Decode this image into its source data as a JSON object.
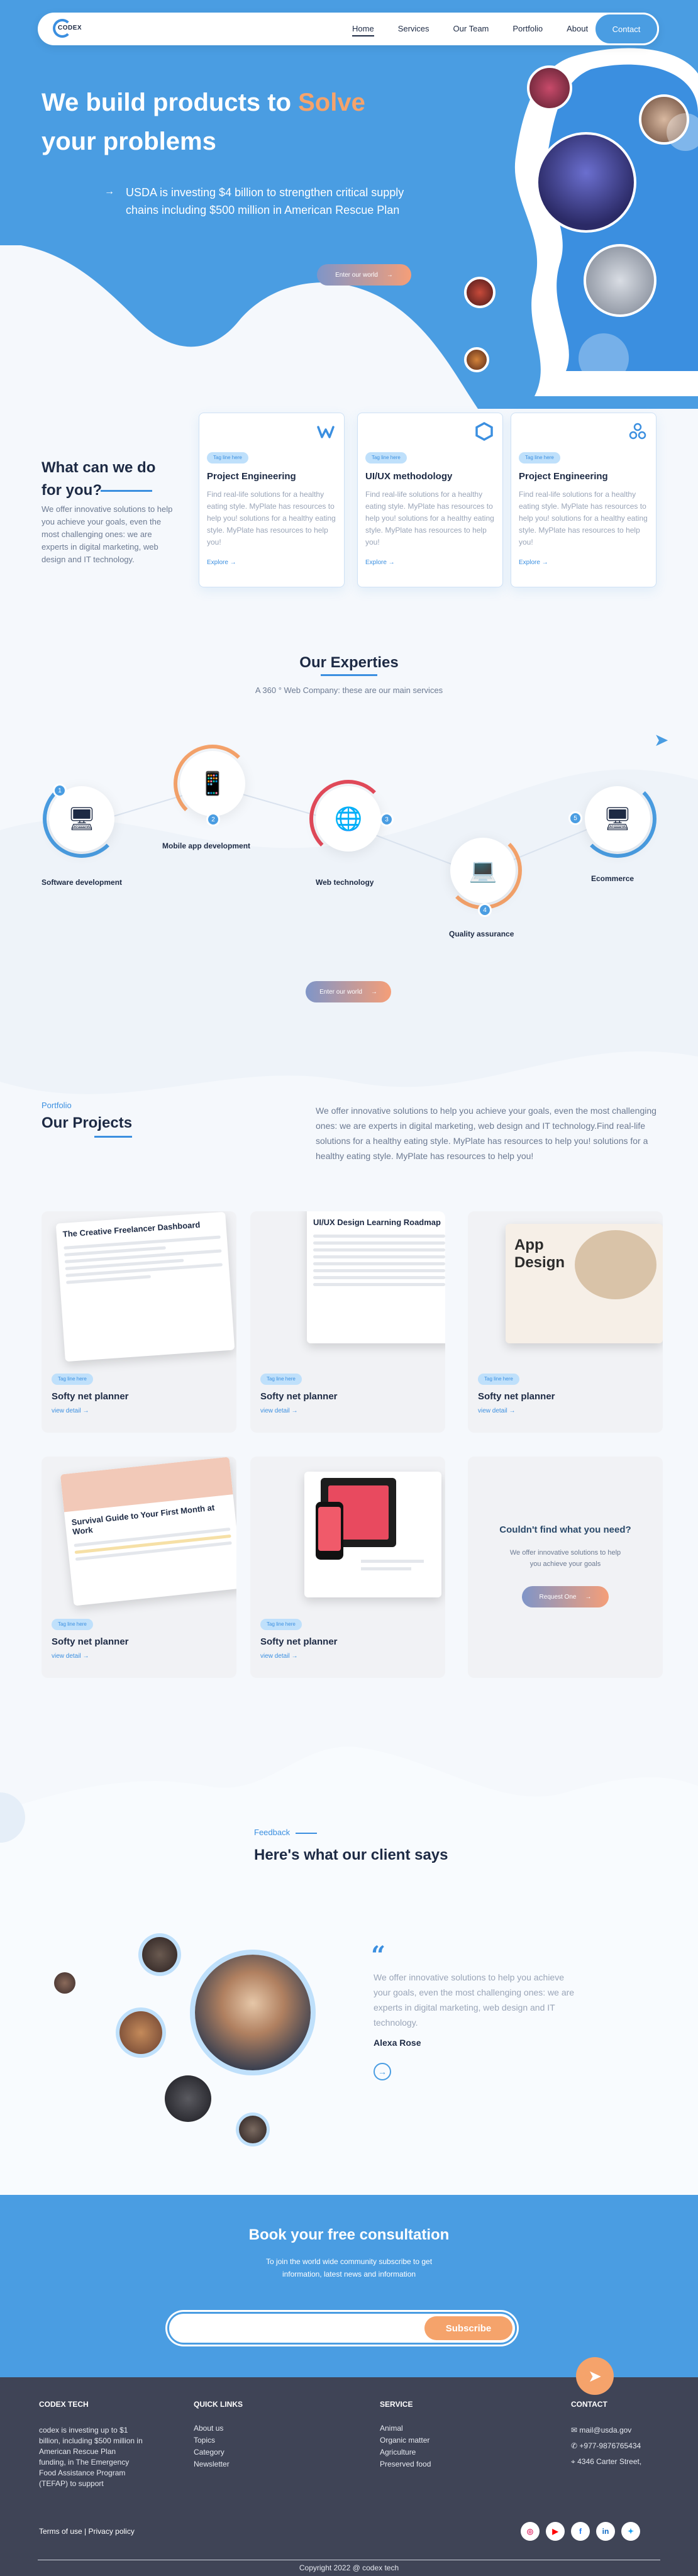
{
  "nav": {
    "logo": "CODEX",
    "links": [
      "Home",
      "Services",
      "Our Team",
      "Portfolio",
      "About"
    ],
    "contact": "Contact"
  },
  "hero": {
    "title_part1": "We build products to ",
    "title_highlight": "Solve",
    "title_part2": "your problems",
    "subtitle": "USDA is investing $4 billion to strengthen critical supply chains including $500 million in American Rescue Plan",
    "button": "Enter our world"
  },
  "services": {
    "title": "What can we do for you?",
    "description": "We offer innovative solutions to help you achieve your goals, even the most challenging ones: we are experts in digital marketing, web design and IT technology.",
    "cards": [
      {
        "tag": "Tag line here",
        "title": "Project Engineering",
        "text": "Find real-life solutions for a healthy eating style. MyPlate has resources to help you! solutions for a healthy eating style. MyPlate has resources to help you!",
        "more": "Explore",
        "icon": "w-logo-icon"
      },
      {
        "tag": "Tag line here",
        "title": "UI/UX methodology",
        "text": "Find real-life solutions for a healthy eating style. MyPlate has resources to help you! solutions for a healthy eating style. MyPlate has resources to help you!",
        "more": "Explore",
        "icon": "hexagon-icon"
      },
      {
        "tag": "Tag line here",
        "title": "Project Engineering",
        "text": "Find real-life solutions for a healthy eating style. MyPlate has resources to help you! solutions for a healthy eating style. MyPlate has resources to help you!",
        "more": "Explore",
        "icon": "network-icon"
      }
    ]
  },
  "expertise": {
    "title": "Our Experties",
    "subtitle": "A 360 ° Web Company: these are our main services",
    "items": [
      {
        "num": "1",
        "label": "Software development"
      },
      {
        "num": "2",
        "label": "Mobile app development"
      },
      {
        "num": "3",
        "label": "Web technology"
      },
      {
        "num": "4",
        "label": "Quality assurance"
      },
      {
        "num": "5",
        "label": "Ecommerce"
      }
    ],
    "button": "Enter our world"
  },
  "projects": {
    "eyebrow": "Portfolio",
    "title": "Our Projects",
    "description": "We offer innovative solutions to help you achieve your goals, even the most challenging ones: we are experts in digital marketing, web design and IT technology.Find real-life solutions for a healthy eating style. MyPlate has resources to help you! solutions for a healthy eating style. MyPlate has resources to help you!",
    "cards": [
      {
        "tag": "Tag line here",
        "name": "Softy net planner",
        "view": "view detail",
        "shot_title": "The Creative Freelancer Dashboard"
      },
      {
        "tag": "Tag line here",
        "name": "Softy net planner",
        "view": "view detail",
        "shot_title": "UI/UX Design Learning Roadmap"
      },
      {
        "tag": "Tag line here",
        "name": "Softy net planner",
        "view": "view detail",
        "shot_title": "App Design"
      },
      {
        "tag": "Tag line here",
        "name": "Softy net planner",
        "view": "view detail",
        "shot_title": "Survival Guide to Your First Month at Work"
      },
      {
        "tag": "Tag line here",
        "name": "Softy net planner",
        "view": "view detail",
        "shot_title": ""
      }
    ],
    "cta": {
      "title": "Couldn't find what you need?",
      "text": "We offer innovative solutions to help you achieve your goals",
      "button": "Request One"
    }
  },
  "feedback": {
    "eyebrow": "Feedback",
    "title": "Here's what our client says",
    "quote": "We offer innovative solutions to help you achieve your goals, even the most challenging ones: we are experts in digital marketing, web design and IT technology.",
    "name": "Alexa Rose"
  },
  "consultation": {
    "title": "Book your free consultation",
    "text": "To join the world wide community subscribe to get information, latest news and information",
    "button": "Subscribe"
  },
  "footer": {
    "brand": "CODEX TECH",
    "brand_text": "codex is investing up to $1 billion, including $500 million in American Rescue Plan funding, in The Emergency Food Assistance Program (TEFAP) to support",
    "quick_title": "QUICK LINKS",
    "quick_links": [
      "About us",
      "Topics",
      "Category",
      "Newsletter"
    ],
    "service_title": "SERVICE",
    "service_links": [
      "Animal",
      "Organic matter",
      "Agriculture",
      "Preserved food"
    ],
    "contact_title": "CONTACT",
    "contact": [
      "mail@usda.gov",
      "+977-9876765434",
      "4346 Carter Street,"
    ],
    "terms": "Terms of use | Privacy policy",
    "copyright": "Copyright 2022 @ codex tech"
  }
}
